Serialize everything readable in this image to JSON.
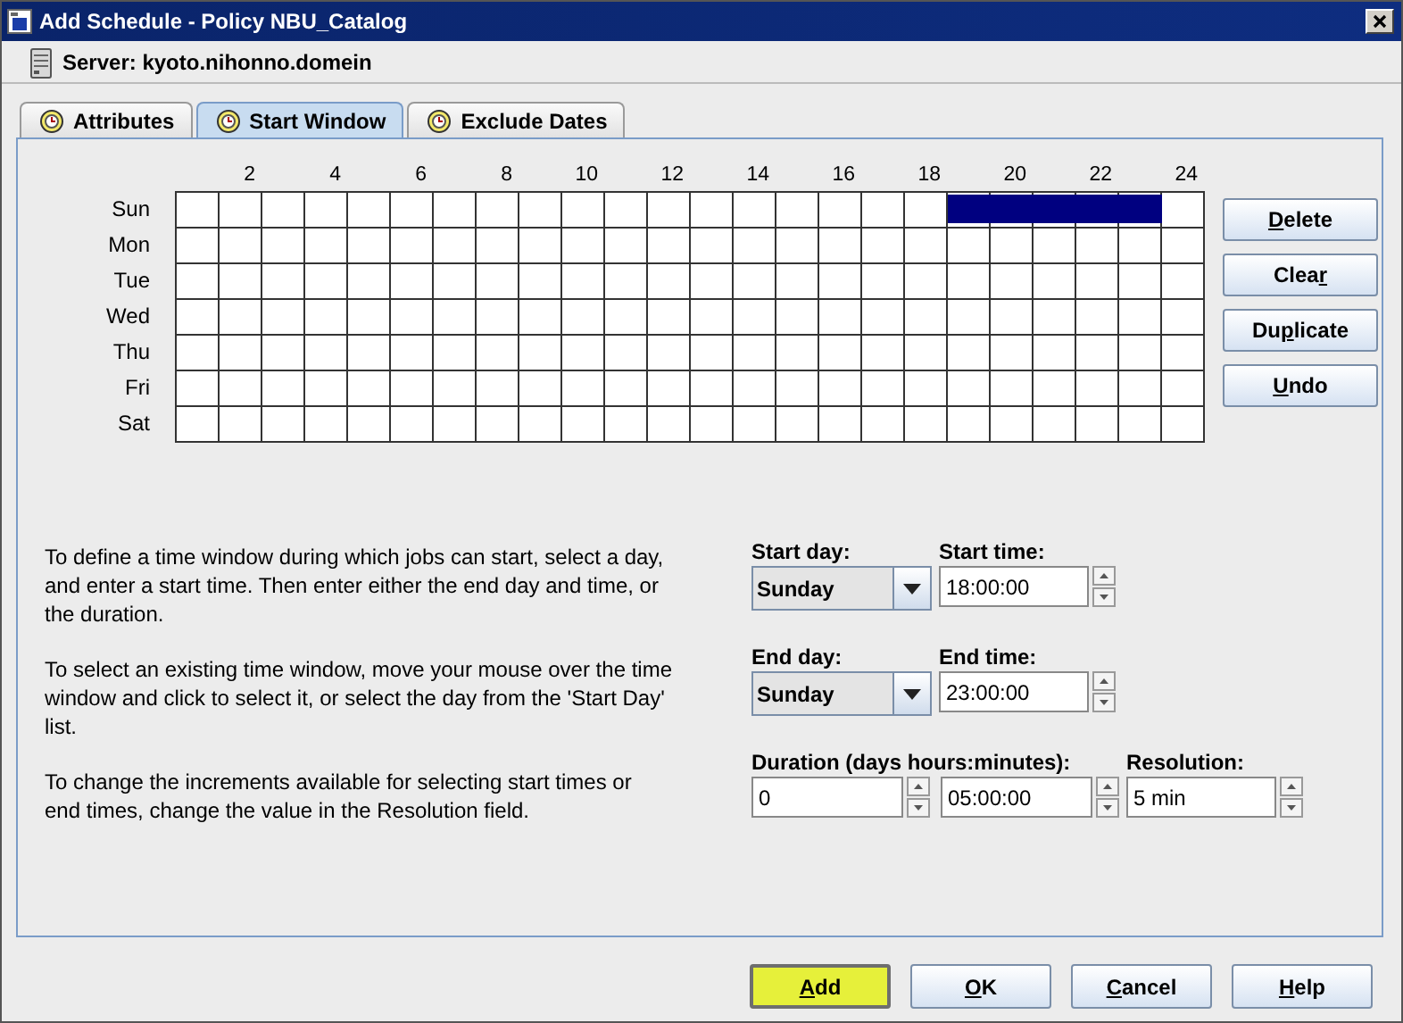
{
  "window": {
    "title": "Add Schedule - Policy NBU_Catalog"
  },
  "server": {
    "label": "Server: kyoto.nihonno.domein"
  },
  "tabs": [
    {
      "label": "Attributes",
      "selected": false
    },
    {
      "label": "Start Window",
      "selected": true
    },
    {
      "label": "Exclude Dates",
      "selected": false
    }
  ],
  "schedule_grid": {
    "hour_labels": [
      "2",
      "4",
      "6",
      "8",
      "10",
      "12",
      "14",
      "16",
      "18",
      "20",
      "22",
      "24"
    ],
    "rows": [
      {
        "day": "Sun",
        "selected_hours": [
          false,
          false,
          false,
          false,
          false,
          false,
          false,
          false,
          false,
          false,
          false,
          false,
          false,
          false,
          false,
          false,
          false,
          false,
          true,
          true,
          true,
          true,
          true,
          false
        ]
      },
      {
        "day": "Mon",
        "selected_hours": [
          false,
          false,
          false,
          false,
          false,
          false,
          false,
          false,
          false,
          false,
          false,
          false,
          false,
          false,
          false,
          false,
          false,
          false,
          false,
          false,
          false,
          false,
          false,
          false
        ]
      },
      {
        "day": "Tue",
        "selected_hours": [
          false,
          false,
          false,
          false,
          false,
          false,
          false,
          false,
          false,
          false,
          false,
          false,
          false,
          false,
          false,
          false,
          false,
          false,
          false,
          false,
          false,
          false,
          false,
          false
        ]
      },
      {
        "day": "Wed",
        "selected_hours": [
          false,
          false,
          false,
          false,
          false,
          false,
          false,
          false,
          false,
          false,
          false,
          false,
          false,
          false,
          false,
          false,
          false,
          false,
          false,
          false,
          false,
          false,
          false,
          false
        ]
      },
      {
        "day": "Thu",
        "selected_hours": [
          false,
          false,
          false,
          false,
          false,
          false,
          false,
          false,
          false,
          false,
          false,
          false,
          false,
          false,
          false,
          false,
          false,
          false,
          false,
          false,
          false,
          false,
          false,
          false
        ]
      },
      {
        "day": "Fri",
        "selected_hours": [
          false,
          false,
          false,
          false,
          false,
          false,
          false,
          false,
          false,
          false,
          false,
          false,
          false,
          false,
          false,
          false,
          false,
          false,
          false,
          false,
          false,
          false,
          false,
          false
        ]
      },
      {
        "day": "Sat",
        "selected_hours": [
          false,
          false,
          false,
          false,
          false,
          false,
          false,
          false,
          false,
          false,
          false,
          false,
          false,
          false,
          false,
          false,
          false,
          false,
          false,
          false,
          false,
          false,
          false,
          false
        ]
      }
    ]
  },
  "grid_buttons": [
    {
      "key": "D",
      "rest": "elete"
    },
    {
      "lead": "Clea",
      "key": "r"
    },
    {
      "lead": "Du",
      "key": "p",
      "rest": "licate"
    },
    {
      "key": "U",
      "rest": "ndo"
    }
  ],
  "instructions": [
    "To define a time window during which jobs can start, select a day, and enter a start time. Then enter either the end day and time, or the duration.",
    "To select an existing time window, move your mouse over the time window and click to select it, or select the day from the 'Start Day' list.",
    "To change the increments available for selecting start times or end times, change the value in the Resolution field."
  ],
  "form_rows": [
    [
      {
        "label": "Start day:",
        "controls": [
          {
            "kind": "combo",
            "value": "Sunday"
          }
        ]
      },
      {
        "label": "Start time:",
        "controls": [
          {
            "kind": "spinner",
            "value": "18:00:00"
          }
        ]
      }
    ],
    [
      {
        "label": "End day:",
        "controls": [
          {
            "kind": "combo",
            "value": "Sunday"
          }
        ]
      },
      {
        "label": "End time:",
        "controls": [
          {
            "kind": "spinner",
            "value": "23:00:00"
          }
        ]
      }
    ],
    [
      {
        "label": "Duration (days hours:minutes):",
        "controls": [
          {
            "kind": "spinner",
            "value": "0"
          },
          {
            "kind": "spinner",
            "value": "05:00:00"
          }
        ]
      },
      {
        "label": "Resolution:",
        "controls": [
          {
            "kind": "spinner",
            "value": "5 min"
          }
        ]
      }
    ]
  ],
  "dialog_buttons": [
    {
      "key": "A",
      "rest": "dd",
      "highlighted": true
    },
    {
      "key": "O",
      "rest": "K",
      "highlighted": false
    },
    {
      "key": "C",
      "rest": "ancel",
      "highlighted": false
    },
    {
      "key": "H",
      "rest": "elp",
      "highlighted": false
    }
  ]
}
